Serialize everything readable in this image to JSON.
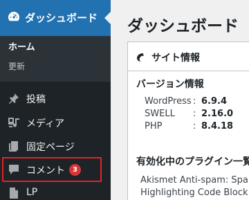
{
  "sidebar": {
    "dashboard": {
      "label": "ダッシュボード",
      "icon": "dashboard-gauge-icon"
    },
    "submenu": {
      "home": "ホーム",
      "update": "更新"
    },
    "items": [
      {
        "label": "投稿",
        "icon": "pushpin-icon"
      },
      {
        "label": "メディア",
        "icon": "media-icon"
      },
      {
        "label": "固定ページ",
        "icon": "page-icon"
      },
      {
        "label": "コメント",
        "icon": "comment-icon",
        "badge": "3"
      },
      {
        "label": "LP",
        "icon": "document-icon"
      }
    ]
  },
  "main": {
    "title": "ダッシュボード",
    "panel": {
      "title": "サイト情報",
      "icon": "swell-logo-icon",
      "version_section_title": "バージョン情報",
      "versions": [
        {
          "name": "WordPress",
          "sep": ":",
          "value": "6.9.4"
        },
        {
          "name": "SWELL",
          "sep": ":",
          "value": "2.16.0"
        },
        {
          "name": "PHP",
          "sep": ":",
          "value": "8.4.18"
        }
      ],
      "plugins_section_title": "有効化中のプラグイン一覧",
      "plugins": [
        "Akismet Anti-spam: Spam Protection",
        "Highlighting Code Block"
      ]
    }
  },
  "colors": {
    "sidebar_bg": "#1d2327",
    "active_bg": "#2271b1",
    "badge": "#d63638",
    "highlight_border": "#e02424"
  }
}
